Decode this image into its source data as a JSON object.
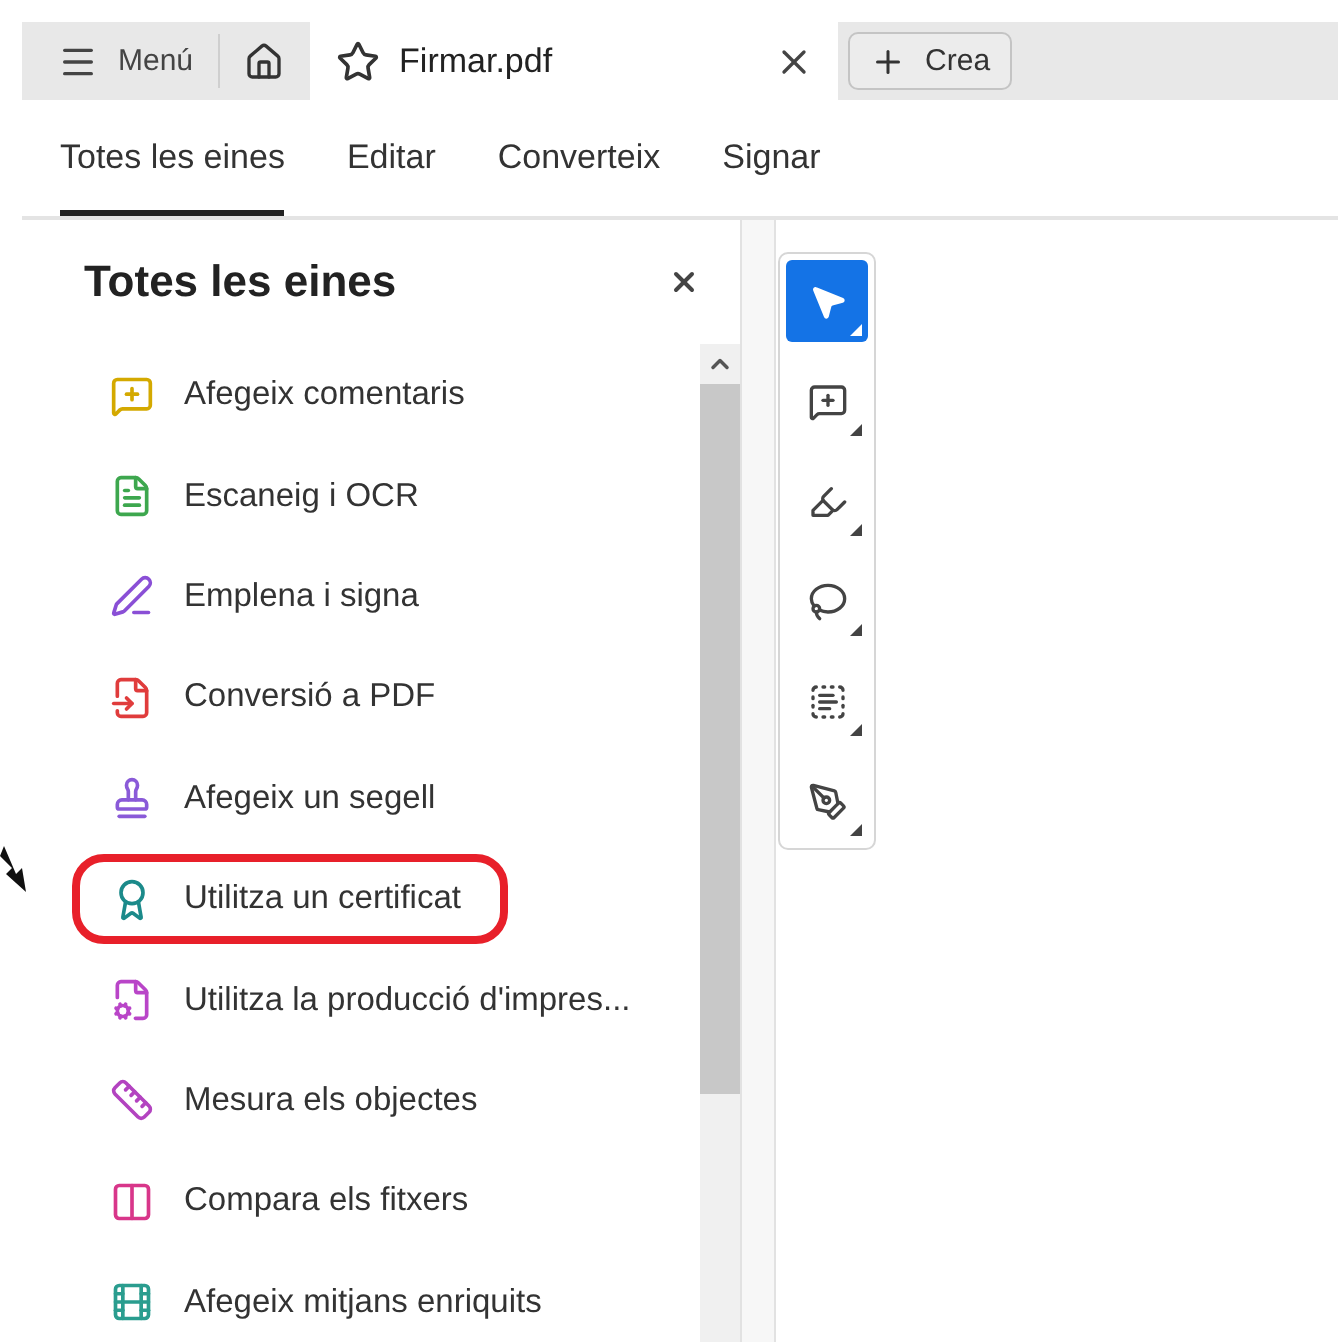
{
  "top_bar": {
    "menu_label": "Menú",
    "file_tab": {
      "title": "Firmar.pdf"
    },
    "create_label": "Crea"
  },
  "tabs": [
    {
      "label": "Totes les eines",
      "selected": true
    },
    {
      "label": "Editar",
      "selected": false
    },
    {
      "label": "Converteix",
      "selected": false
    },
    {
      "label": "Signar",
      "selected": false
    }
  ],
  "panel": {
    "title": "Totes les eines",
    "items": [
      {
        "label": "Afegeix comentaris",
        "color": "#d4a900",
        "highlighted": false
      },
      {
        "label": "Escaneig i OCR",
        "color": "#3da74e",
        "highlighted": false
      },
      {
        "label": "Emplena i signa",
        "color": "#8a4fd6",
        "highlighted": false
      },
      {
        "label": "Conversió a PDF",
        "color": "#e03c3c",
        "highlighted": false
      },
      {
        "label": "Afegeix un segell",
        "color": "#8a5ad8",
        "highlighted": false
      },
      {
        "label": "Utilitza un certificat",
        "color": "#1b8a8a",
        "highlighted": true
      },
      {
        "label": "Utilitza la producció d'impres...",
        "color": "#b945c8",
        "highlighted": false
      },
      {
        "label": "Mesura els objectes",
        "color": "#b343c0",
        "highlighted": false
      },
      {
        "label": "Compara els fitxers",
        "color": "#d8368a",
        "highlighted": false
      },
      {
        "label": "Afegeix mitjans enriquits",
        "color": "#2a9d8f",
        "highlighted": false
      }
    ]
  },
  "tools": [
    {
      "selected": true
    },
    {
      "selected": false
    },
    {
      "selected": false
    },
    {
      "selected": false
    },
    {
      "selected": false
    },
    {
      "selected": false
    }
  ]
}
